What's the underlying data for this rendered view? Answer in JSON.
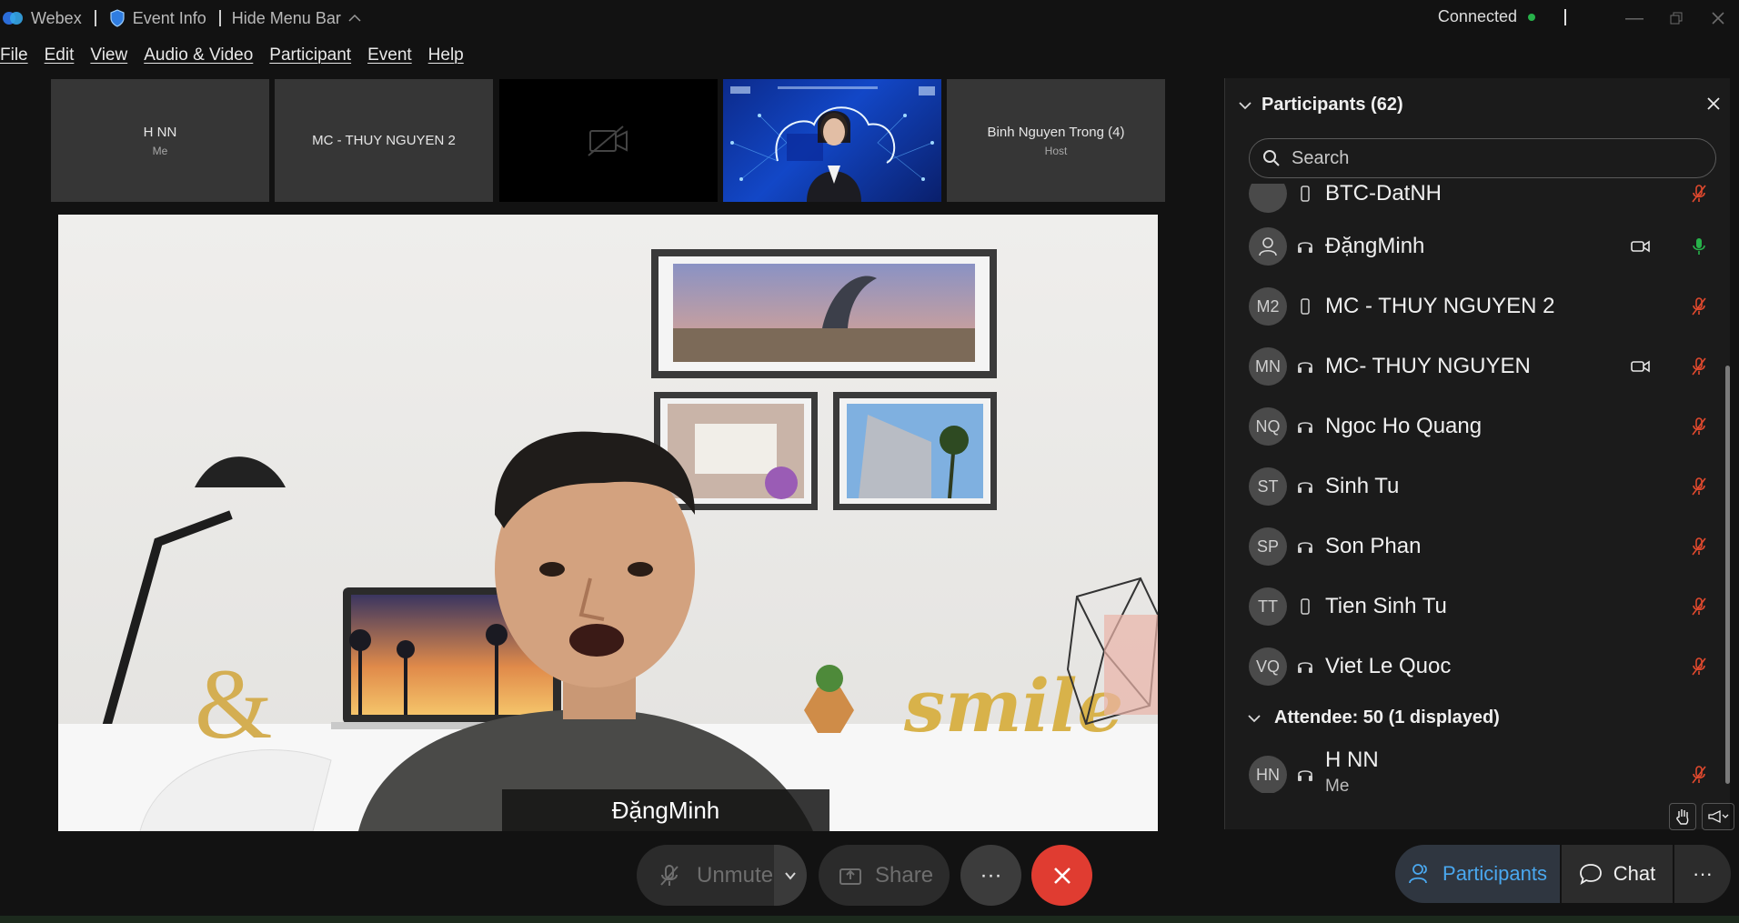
{
  "titlebar": {
    "app_name": "Webex",
    "event_info": "Event Info",
    "hide_menu": "Hide Menu Bar",
    "status": "Connected"
  },
  "menu": [
    "File",
    "Edit",
    "View",
    "Audio & Video",
    "Participant",
    "Event",
    "Help"
  ],
  "thumbnails": [
    {
      "name": "H NN",
      "sub": "Me"
    },
    {
      "name": "MC - THUY NGUYEN 2",
      "sub": ""
    },
    {
      "name": "",
      "sub": ""
    },
    {
      "name": "",
      "sub": ""
    },
    {
      "name": "Binh Nguyen Trong (4)",
      "sub": "Host"
    }
  ],
  "main_video": {
    "speaker": "ĐặngMinh"
  },
  "controls": {
    "unmute": "Unmute",
    "share": "Share",
    "more": "···"
  },
  "panel": {
    "title": "Participants (62)",
    "search_placeholder": "Search",
    "partial_row": "BTC-DatNH",
    "participants": [
      {
        "initials": "",
        "name": "ĐặngMinh",
        "device": "headset",
        "video": true,
        "mic": "on"
      },
      {
        "initials": "M2",
        "name": "MC - THUY NGUYEN 2",
        "device": "phone",
        "video": false,
        "mic": "muted"
      },
      {
        "initials": "MN",
        "name": "MC- THUY NGUYEN",
        "device": "headset",
        "video": true,
        "mic": "muted"
      },
      {
        "initials": "NQ",
        "name": "Ngoc Ho Quang",
        "device": "headset",
        "video": false,
        "mic": "muted"
      },
      {
        "initials": "ST",
        "name": "Sinh Tu",
        "device": "headset",
        "video": false,
        "mic": "muted"
      },
      {
        "initials": "SP",
        "name": "Son Phan",
        "device": "headset",
        "video": false,
        "mic": "muted"
      },
      {
        "initials": "TT",
        "name": "Tien Sinh Tu",
        "device": "phone",
        "video": false,
        "mic": "muted"
      },
      {
        "initials": "VQ",
        "name": "Viet Le Quoc",
        "device": "headset",
        "video": false,
        "mic": "muted"
      }
    ],
    "attendee_section": "Attendee: 50 (1 displayed)",
    "attendee": {
      "initials": "HN",
      "name": "H NN",
      "sub": "Me"
    }
  },
  "bottom_right": {
    "participants": "Participants",
    "chat": "Chat",
    "more": "···"
  },
  "colors": {
    "accent": "#3aa0e6",
    "end_call": "#e03c31",
    "mic_on": "#27b24a",
    "mic_muted": "#e0492e"
  }
}
